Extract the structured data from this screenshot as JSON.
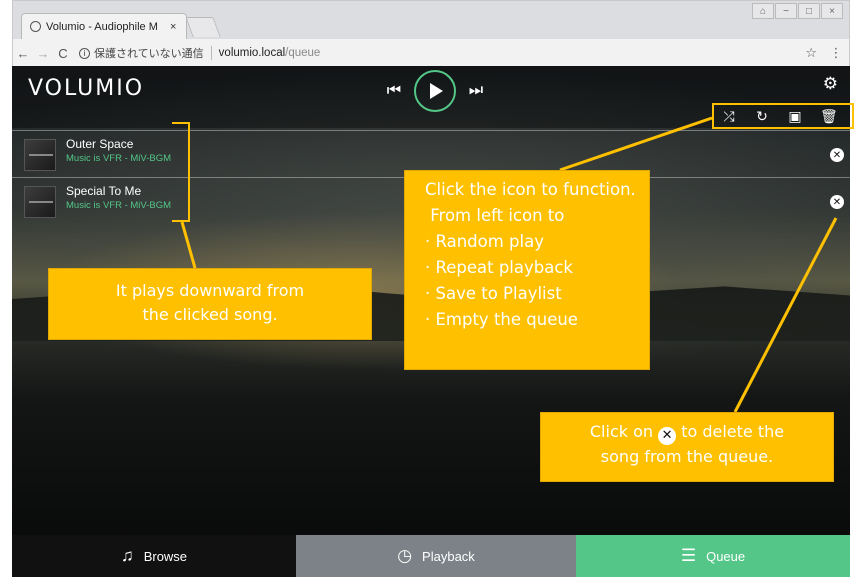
{
  "browser": {
    "tab_title": "Volumio - Audiophile M",
    "tab_close": "×",
    "info_icon": "ⓘ",
    "security_text": "保護されていない通信",
    "url_host": "volumio.local",
    "url_path": "/queue",
    "window_controls": [
      "⌂",
      "−",
      "□",
      "×"
    ]
  },
  "app": {
    "logo": "VOLUMIO",
    "transport": {
      "prev": "⏮",
      "next": "⏭"
    },
    "queue_tools": [
      "random-icon",
      "repeat-icon",
      "save-icon",
      "trash-icon"
    ]
  },
  "queue": [
    {
      "title": "Outer Space",
      "artist": "Music is VFR - MiV-BGM"
    },
    {
      "title": "Special To Me",
      "artist": "Music is VFR - MiV-BGM"
    }
  ],
  "footer": {
    "browse": "Browse",
    "playback": "Playback",
    "queue": "Queue"
  },
  "colors": {
    "accent": "#54c688",
    "callout": "#ffc000",
    "playback_tab": "#7c8288"
  },
  "annotations": {
    "plays_line1": "It plays downward from",
    "plays_line2": "the clicked song.",
    "tools_lines": [
      "Click the icon to function.",
      " From left icon to",
      "· Random play",
      "· Repeat playback",
      "· Save to Playlist",
      "· Empty the queue"
    ],
    "delete_pre": "Click on",
    "delete_post": "to delete the",
    "delete_line2": "song from the queue."
  }
}
